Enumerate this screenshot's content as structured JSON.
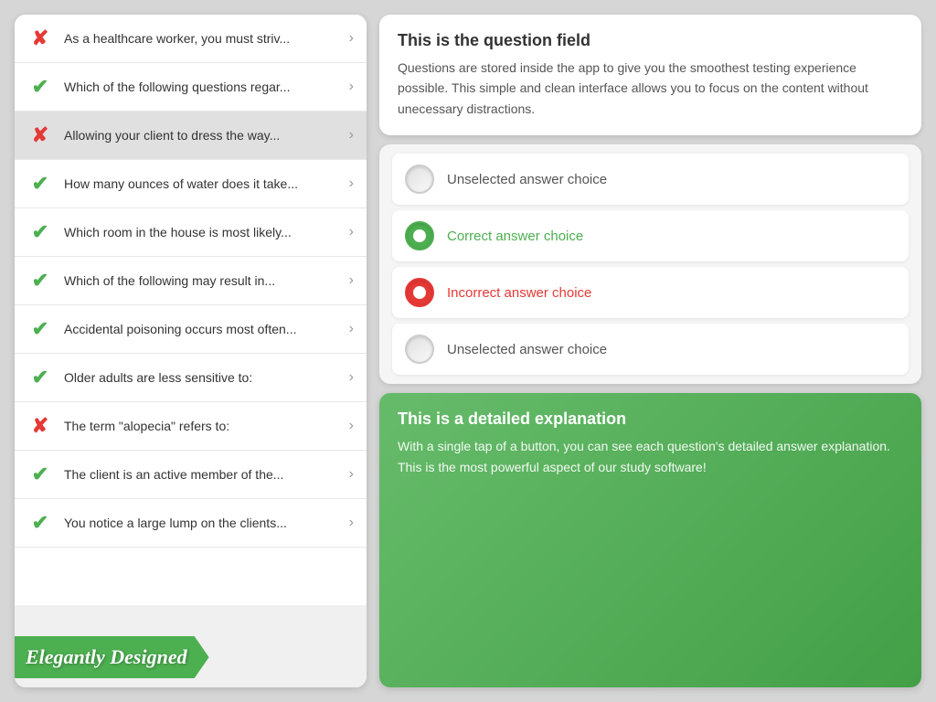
{
  "left": {
    "questions": [
      {
        "id": 1,
        "status": "incorrect",
        "text": "As a healthcare worker, you must striv..."
      },
      {
        "id": 2,
        "status": "correct",
        "text": "Which of the following questions regar..."
      },
      {
        "id": 3,
        "status": "incorrect",
        "text": "Allowing your client to dress the way...",
        "active": true
      },
      {
        "id": 4,
        "status": "correct",
        "text": "How many ounces of water does it take..."
      },
      {
        "id": 5,
        "status": "correct",
        "text": "Which room in the house is most likely..."
      },
      {
        "id": 6,
        "status": "correct",
        "text": "Which of the following may result in..."
      },
      {
        "id": 7,
        "status": "correct",
        "text": "Accidental poisoning occurs most often..."
      },
      {
        "id": 8,
        "status": "correct",
        "text": "Older adults are less sensitive to:"
      },
      {
        "id": 9,
        "status": "incorrect",
        "text": "The term \"alopecia\" refers to:"
      },
      {
        "id": 10,
        "status": "correct",
        "text": "The client is an active member of the..."
      },
      {
        "id": 11,
        "status": "correct",
        "text": "You notice a large lump on the clients..."
      }
    ],
    "banner_text": "Elegantly Designed"
  },
  "right": {
    "question_card": {
      "title": "This is the question field",
      "body": "Questions are stored inside the app to give you the smoothest testing experience possible. This simple and clean interface allows you to focus on the content without unecessary distractions."
    },
    "answers": [
      {
        "id": 1,
        "state": "unselected",
        "label": "Unselected answer choice"
      },
      {
        "id": 2,
        "state": "correct",
        "label": "Correct answer choice"
      },
      {
        "id": 3,
        "state": "incorrect",
        "label": "Incorrect answer choice"
      },
      {
        "id": 4,
        "state": "unselected",
        "label": "Unselected answer choice"
      }
    ],
    "explanation_card": {
      "title": "This is a detailed explanation",
      "body": "With a single tap of a button, you can see each question's detailed answer explanation. This is the most powerful aspect of our study software!"
    }
  }
}
